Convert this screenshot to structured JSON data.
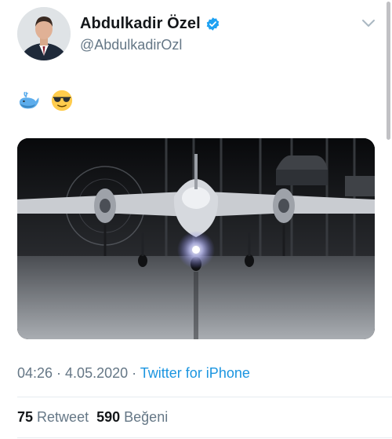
{
  "tweet": {
    "author": {
      "display_name": "Abdulkadir Özel",
      "handle": "@AbdulkadirOzl",
      "verified": true
    },
    "emojis": [
      "whale-emoji",
      "sunglasses-face-emoji"
    ],
    "media": {
      "type": "image",
      "subject": "drone-on-runway"
    },
    "time": "04:26",
    "date": "4.05.2020",
    "source": "Twitter for iPhone",
    "separator": " · ",
    "stats": {
      "retweet_count": "75",
      "retweet_label": "Retweet",
      "like_count": "590",
      "like_label": "Beğeni"
    }
  },
  "colors": {
    "secondary_text": "#657786",
    "link": "#1b95e0",
    "verified": "#1da1f2",
    "divider": "#e6ecf0"
  }
}
